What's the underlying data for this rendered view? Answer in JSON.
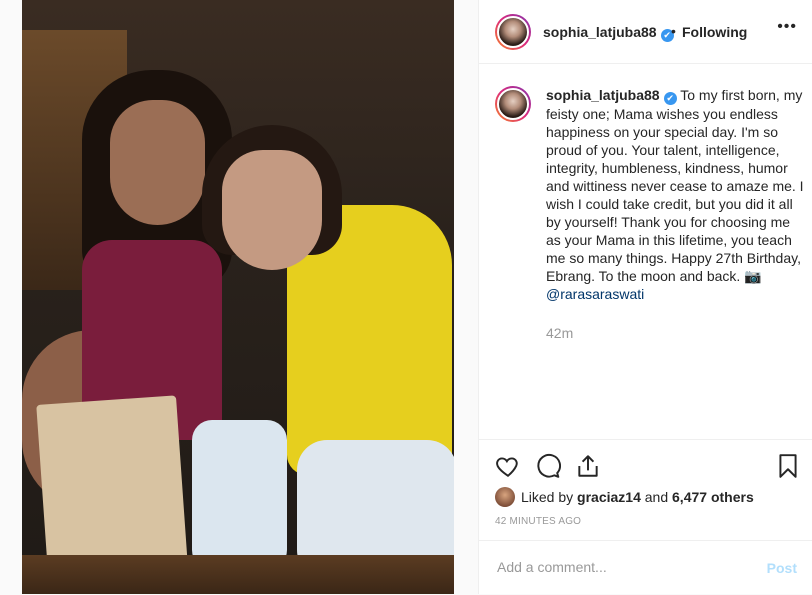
{
  "post": {
    "username": "sophia_latjuba88",
    "verified_mark": "✔",
    "separator": "•",
    "follow_label": "Following",
    "more_label": "•••",
    "caption_text": "To my first born, my feisty one; Mama wishes you endless happiness on your special day. I'm so proud of you. Your talent, intelligence, integrity, humbleness, kindness, humor and wittiness never cease to amaze me. I wish I could take credit, but you did it all by yourself! Thank you for choosing me as your Mama in this lifetime, you teach me so many things. Happy 27th Birthday, Ebrang. To the moon and back. 📷",
    "caption_mention": "@rarasaraswati",
    "time_short": "42m"
  },
  "actions": {
    "icons": [
      "heart-icon",
      "comment-icon",
      "share-icon",
      "bookmark-icon"
    ]
  },
  "likes": {
    "prefix": "Liked by",
    "user": "graciaz14",
    "conjunction": "and",
    "count": "6,477 others"
  },
  "timestamp": "42 MINUTES AGO",
  "comment": {
    "placeholder": "Add a comment...",
    "post_label": "Post"
  },
  "colors": {
    "link": "#003569",
    "verified": "#3897f0",
    "post_disabled": "#b2dffc",
    "muted": "#999999"
  }
}
